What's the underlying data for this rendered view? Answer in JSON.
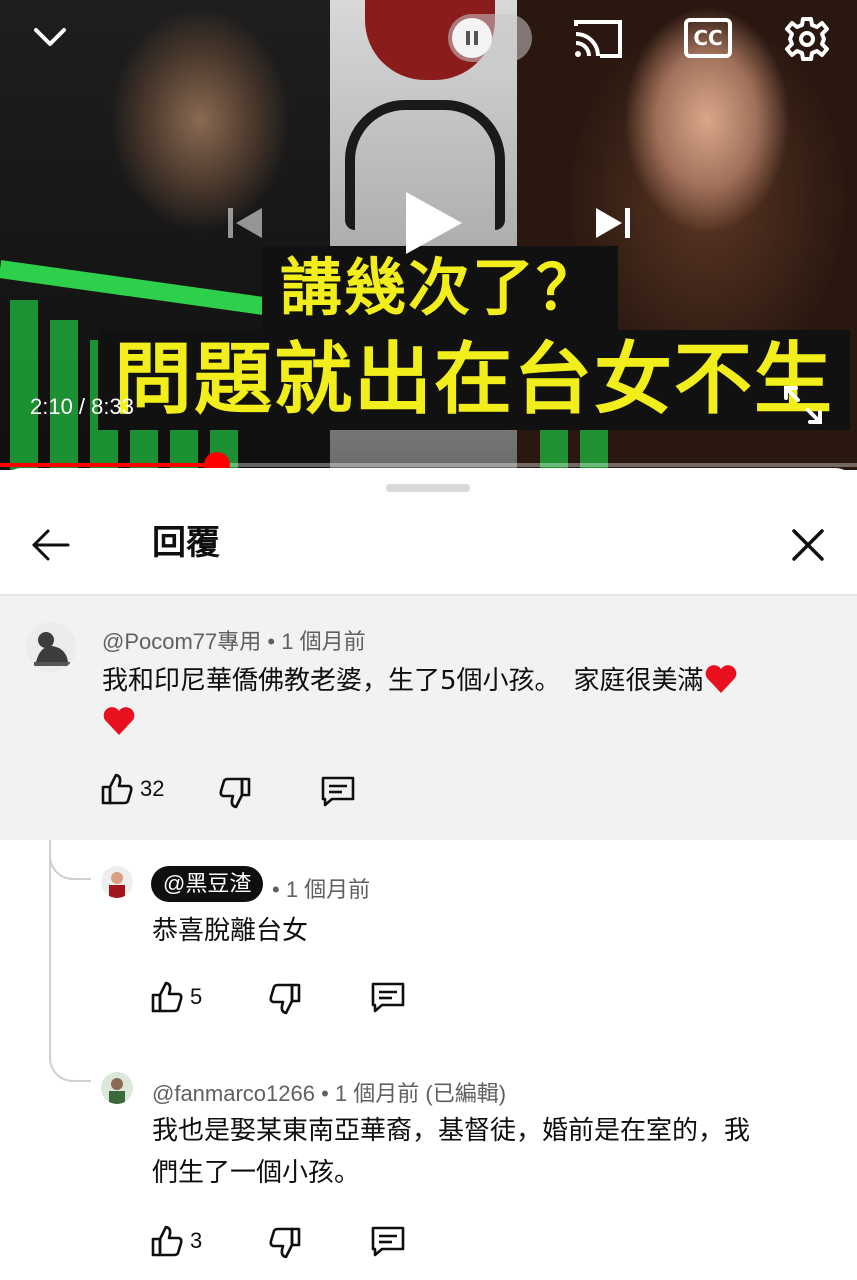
{
  "player": {
    "caption_line1": "講幾次了？",
    "caption_line2": "問題就出在台女不生",
    "time_display": "2:10 / 8:33",
    "cc_label": "CC",
    "progress_fraction": 0.253,
    "autoplay_on": false,
    "accent_color": "#ff0000",
    "caption_color": "#f2ee1c"
  },
  "sheet": {
    "title": "回覆"
  },
  "parent_comment": {
    "author": "@Pocom77專用",
    "time": "• 1 個月前",
    "text_line1": "我和印尼華僑佛教老婆，生了5個小孩。　家庭很美滿",
    "likes": "32"
  },
  "replies": [
    {
      "author": "@黑豆渣",
      "author_highlighted": true,
      "time": "• 1 個月前",
      "text_line1": "恭喜脫離台女",
      "text_line2": "",
      "likes": "5"
    },
    {
      "author": "@fanmarco1266",
      "author_highlighted": false,
      "time": "• 1 個月前 (已編輯)",
      "text_line1": "我也是娶某東南亞華裔，基督徒，婚前是在室的，我",
      "text_line2": "們生了一個小孩。",
      "likes": "3"
    }
  ],
  "icons": [
    "chevron-down-icon",
    "pause-icon",
    "cast-icon",
    "cc-icon",
    "gear-icon",
    "previous-icon",
    "play-icon",
    "next-icon",
    "fullscreen-icon",
    "back-arrow-icon",
    "close-icon",
    "heart-emoji-icon",
    "thumbs-up-icon",
    "thumbs-down-icon",
    "reply-icon"
  ]
}
